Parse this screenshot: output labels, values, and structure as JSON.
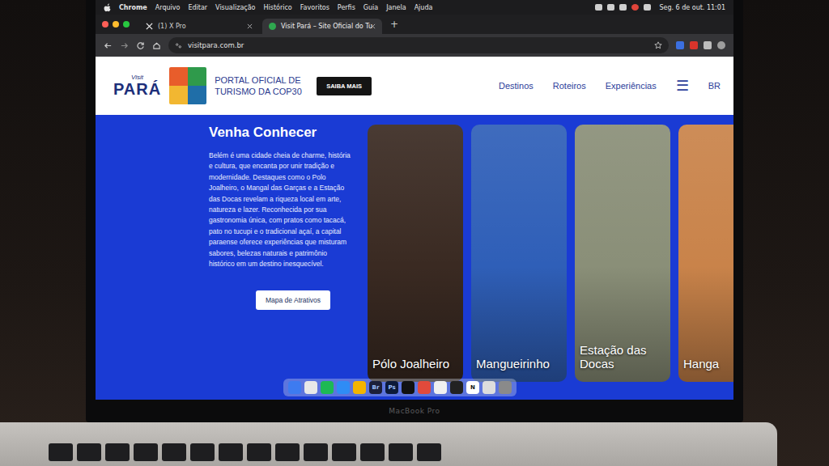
{
  "menubar": {
    "items": [
      "Chrome",
      "Arquivo",
      "Editar",
      "Visualização",
      "Histórico",
      "Favoritos",
      "Perfis",
      "Guia",
      "Janela",
      "Ajuda"
    ],
    "clock": "Seg. 6 de out.  11:01"
  },
  "tabs": [
    {
      "label": "(1) X Pro",
      "kind": "x",
      "selected": false
    },
    {
      "label": "Visit Pará – Site Oficial do Tu",
      "kind": "site",
      "selected": true
    }
  ],
  "new_tab": "+",
  "address": "visitpara.com.br",
  "site": {
    "logo": {
      "top": "Visit",
      "name": "PARÁ"
    },
    "banner": "PORTAL OFICIAL DE TURISMO DA COP30",
    "cta": "SAIBA MAIS",
    "nav": [
      "Destinos",
      "Roteiros",
      "Experiências"
    ],
    "menu_icon": "☰",
    "language": "BR"
  },
  "hero": {
    "title": "Venha Conhecer",
    "body": "Belém é uma cidade cheia de charme, história e cultura, que encanta por unir tradição e modernidade. Destaques como o Polo Joalheiro, o Mangal das Garças e a Estação das Docas revelam a riqueza local em arte, natureza e lazer. Reconhecida por sua gastronomia única, com pratos como tacacá, pato no tucupi e o tradicional açaí, a capital paraense oferece experiências que misturam sabores, belezas naturais e patrimônio histórico em um destino inesquecível.",
    "button": "Mapa de Atrativos"
  },
  "cards": [
    {
      "label": "Pólo Joalheiro",
      "color": "#3a2a22"
    },
    {
      "label": "Mangueirinho",
      "color": "#2f5fb8"
    },
    {
      "label": "Estação das Docas",
      "color": "#8a8f78"
    },
    {
      "label": "Hanga",
      "color": "#c9834a"
    }
  ],
  "dock": [
    {
      "color": "#3d7bf0"
    },
    {
      "color": "#e8e8e8"
    },
    {
      "color": "#1db954"
    },
    {
      "color": "#2f8cf5"
    },
    {
      "color": "#f4b400"
    },
    {
      "color": "#1c1f3a",
      "glyph": "Br"
    },
    {
      "color": "#0c1a3a",
      "glyph": "Ps"
    },
    {
      "color": "#111111"
    },
    {
      "color": "#e24a3b"
    },
    {
      "color": "#f0f0f0"
    },
    {
      "color": "#222222"
    },
    {
      "color": "#ffffff",
      "glyph": "N"
    },
    {
      "color": "#dddddd"
    },
    {
      "color": "#8a8a8a"
    }
  ],
  "laptop_label": "MacBook Pro"
}
